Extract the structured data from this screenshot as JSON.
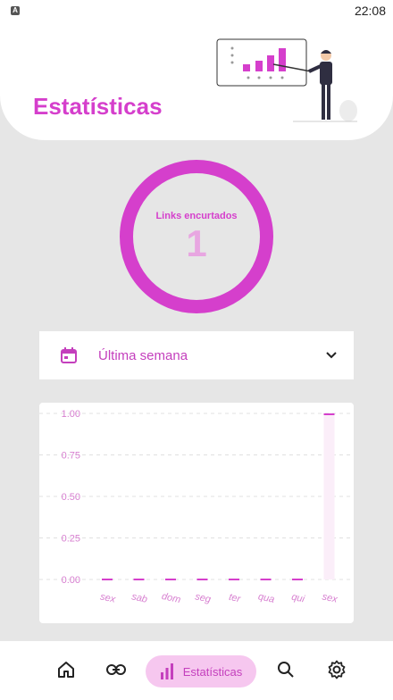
{
  "status_bar": {
    "time": "22:08",
    "icon": "android-system-icon"
  },
  "header": {
    "title": "Estatísticas",
    "illustration": "presenter-with-chart-illustration"
  },
  "summary": {
    "label": "Links encurtados",
    "value": "1",
    "ring_color": "#d53fcc",
    "value_color": "#e8a6e1"
  },
  "period_select": {
    "selected": "Última semana",
    "icon": "calendar-icon",
    "dropdown_icon": "chevron-down-icon"
  },
  "chart_data": {
    "type": "bar",
    "categories": [
      "sex",
      "sab",
      "dom",
      "seg",
      "ter",
      "qua",
      "qui",
      "sex"
    ],
    "values": [
      0,
      0,
      0,
      0,
      0,
      0,
      0,
      1
    ],
    "y_ticks": [
      "1.00",
      "0.75",
      "0.50",
      "0.25",
      "0.00"
    ],
    "ylim": [
      0,
      1
    ],
    "grid": true,
    "bar_color": "#d53fcc"
  },
  "bottom_nav": {
    "items": [
      {
        "name": "home",
        "icon": "home-icon"
      },
      {
        "name": "link",
        "icon": "link-icon"
      },
      {
        "name": "stats",
        "icon": "bar-chart-icon",
        "label": "Estatísticas",
        "active": true
      },
      {
        "name": "search",
        "icon": "search-icon"
      },
      {
        "name": "settings",
        "icon": "gear-icon"
      }
    ]
  },
  "accent_color": "#d53fcc"
}
